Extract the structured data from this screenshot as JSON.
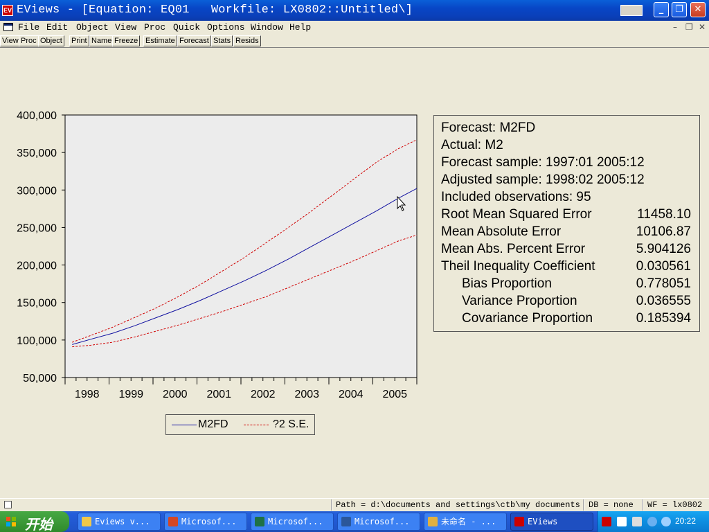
{
  "window": {
    "title": "EViews - [Equation: EQ01   Workfile: LX0802::Untitled\\]"
  },
  "menu": [
    "File",
    "Edit",
    "Object",
    "View",
    "Proc",
    "Quick",
    "Options",
    "Window",
    "Help"
  ],
  "toolbar": [
    "View",
    "Proc",
    "Object",
    "Print",
    "Name",
    "Freeze",
    "Estimate",
    "Forecast",
    "Stats",
    "Resids"
  ],
  "chart_data": {
    "type": "line",
    "title": "",
    "xlabel": "",
    "ylabel": "",
    "x": [
      1998.08,
      1998.5,
      1999.0,
      1999.5,
      2000.0,
      2000.5,
      2001.0,
      2001.5,
      2002.0,
      2002.5,
      2003.0,
      2003.5,
      2004.0,
      2004.5,
      2005.0,
      2005.5,
      2005.92
    ],
    "series": [
      {
        "name": "M2FD",
        "values": [
          94000,
          101000,
          109000,
          119000,
          130000,
          141000,
          153000,
          166000,
          179000,
          193000,
          208000,
          224000,
          240000,
          256000,
          272000,
          289000,
          302000
        ]
      },
      {
        "name": "?2 S.E.",
        "values": [
          97000,
          106000,
          117000,
          130000,
          143000,
          158000,
          174000,
          192000,
          210000,
          230000,
          250000,
          271000,
          293000,
          315000,
          337000,
          355000,
          367000
        ]
      },
      {
        "name": "?2 S.E.",
        "values": [
          91000,
          93000,
          97000,
          104000,
          112000,
          120000,
          129000,
          138000,
          148000,
          158000,
          170000,
          182000,
          194000,
          206000,
          219000,
          232000,
          240000
        ]
      }
    ],
    "ylim": [
      50000,
      400000
    ],
    "yticks": [
      "50,000",
      "100,000",
      "150,000",
      "200,000",
      "250,000",
      "300,000",
      "350,000",
      "400,000"
    ],
    "xticks": [
      "1998",
      "1999",
      "2000",
      "2001",
      "2002",
      "2003",
      "2004",
      "2005"
    ],
    "xlim": [
      1997.92,
      2005.92
    ],
    "legend": "bottom-center",
    "colors": {
      "M2FD": "#1010a0",
      "?2 S.E.": "#d00000"
    }
  },
  "stats": {
    "rows": [
      {
        "label": "Forecast: M2FD",
        "value": ""
      },
      {
        "label": "Actual: M2",
        "value": ""
      },
      {
        "label": "Forecast sample: 1997:01 2005:12",
        "value": ""
      },
      {
        "label": "Adjusted sample: 1998:02 2005:12",
        "value": ""
      },
      {
        "label": "Included observations: 95",
        "value": ""
      },
      {
        "label": "Root Mean Squared Error",
        "value": "11458.10"
      },
      {
        "label": "Mean Absolute Error",
        "value": "10106.87"
      },
      {
        "label": "Mean Abs. Percent Error",
        "value": "5.904126"
      },
      {
        "label": "Theil Inequality Coefficient",
        "value": "0.030561"
      },
      {
        "label": "Bias Proportion",
        "value": "0.778051"
      },
      {
        "label": "Variance Proportion",
        "value": "0.036555"
      },
      {
        "label": "Covariance Proportion",
        "value": "0.185394"
      }
    ]
  },
  "legend": {
    "m2fd": "M2FD",
    "se": "?2 S.E."
  },
  "status": {
    "path": "Path = d:\\documents and settings\\ctb\\my documents",
    "db": "DB = none",
    "wf": "WF = lx0802"
  },
  "taskbar": {
    "start": "开始",
    "tasks": [
      "Eviews v...",
      "Microsof...",
      "Microsof...",
      "Microsof...",
      "未命名 - ...",
      "EViews"
    ],
    "clock": "20:22"
  }
}
